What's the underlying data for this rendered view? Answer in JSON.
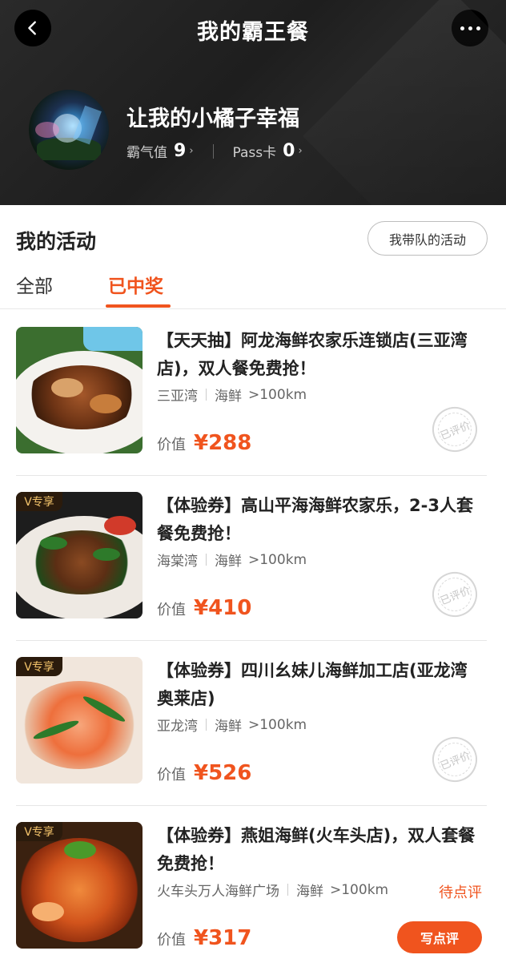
{
  "header": {
    "title": "我的霸王餐",
    "back_icon": "chevron-left-icon",
    "more_icon": "more-dots-icon",
    "user": {
      "name": "让我的小橘子幸福",
      "stat1_label": "霸气值",
      "stat1_value": "9",
      "stat2_label": "Pass卡",
      "stat2_value": "0",
      "arrow": "›"
    }
  },
  "activities": {
    "title": "我的活动",
    "team_button": "我带队的活动",
    "tabs": [
      "全部",
      "已中奖"
    ],
    "active_tab": "已中奖",
    "price_label": "价值",
    "stamp_text": "已评价",
    "items": [
      {
        "title": "【天天抽】阿龙海鲜农家乐连锁店(三亚湾店)，双人餐免费抢！",
        "area": "三亚湾",
        "category": "海鲜",
        "distance": ">100km",
        "price": "¥288",
        "tag": "",
        "status": "reviewed"
      },
      {
        "title": "【体验券】高山平海海鲜农家乐，2-3人套餐免费抢！",
        "area": "海棠湾",
        "category": "海鲜",
        "distance": ">100km",
        "price": "¥410",
        "tag": "V专享",
        "status": "reviewed"
      },
      {
        "title": "【体验券】四川幺妹儿海鲜加工店(亚龙湾奥莱店)",
        "area": "亚龙湾",
        "category": "海鲜",
        "distance": ">100km",
        "price": "¥526",
        "tag": "V专享",
        "status": "reviewed"
      },
      {
        "title": "【体验券】燕姐海鲜(火车头店)，双人套餐免费抢！",
        "area": "火车头万人海鲜广场",
        "category": "海鲜",
        "distance": ">100km",
        "price": "¥317",
        "tag": "V专享",
        "status": "pending",
        "pending_text": "待点评",
        "review_button": "写点评"
      }
    ]
  },
  "colors": {
    "accent": "#f0541e",
    "header_bg": "#222222"
  }
}
